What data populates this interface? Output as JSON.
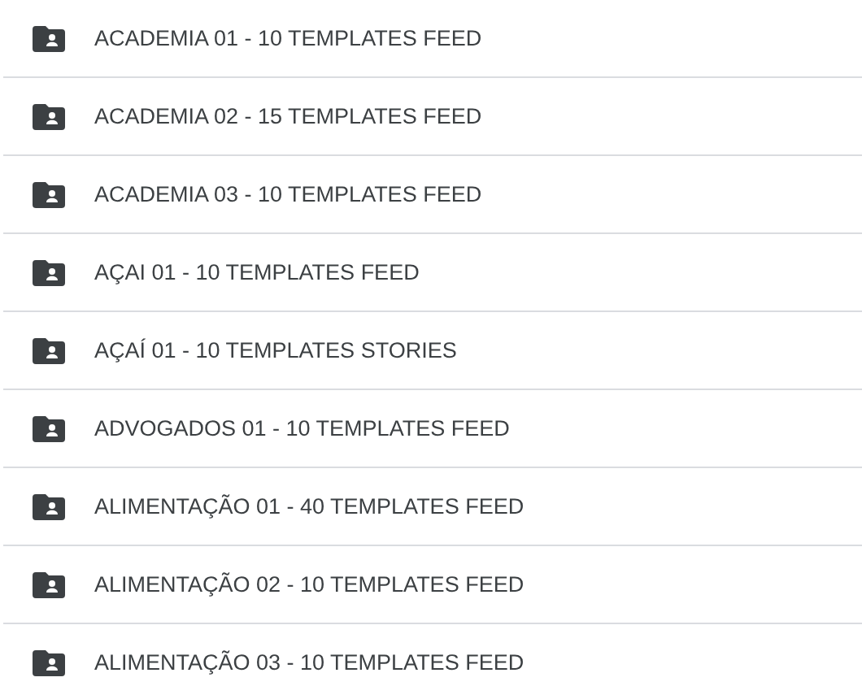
{
  "folders": [
    {
      "name": "ACADEMIA 01 - 10 TEMPLATES FEED"
    },
    {
      "name": "ACADEMIA 02 - 15 TEMPLATES FEED"
    },
    {
      "name": "ACADEMIA 03 - 10 TEMPLATES FEED"
    },
    {
      "name": "AÇAI 01 - 10 TEMPLATES FEED"
    },
    {
      "name": "AÇAÍ 01 - 10 TEMPLATES STORIES"
    },
    {
      "name": "ADVOGADOS 01 - 10 TEMPLATES FEED"
    },
    {
      "name": "ALIMENTAÇÃO 01 - 40 TEMPLATES FEED"
    },
    {
      "name": "ALIMENTAÇÃO 02 - 10 TEMPLATES FEED"
    },
    {
      "name": "ALIMENTAÇÃO 03 - 10 TEMPLATES FEED"
    }
  ]
}
